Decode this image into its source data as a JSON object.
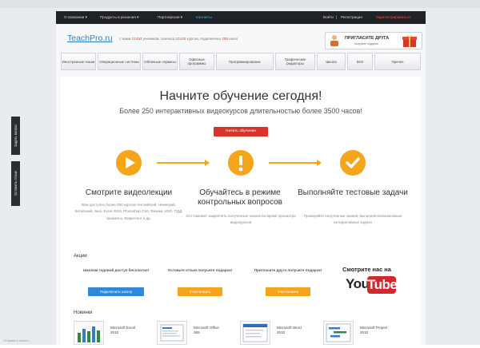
{
  "colors": {
    "accent_orange": "#f4a51c",
    "accent_red": "#d8342a",
    "link_blue": "#2b7fc0",
    "topbar": "#1f2326"
  },
  "topbar": {
    "left_items": [
      "О компании ▾",
      "Продукты и решения ▾",
      "Партнерская ▾",
      "Контакты"
    ],
    "login": "Войти",
    "separator": "|",
    "register": "Регистрация",
    "cart": "Зарегистрироваться"
  },
  "header": {
    "logo": "TeachPro.ru",
    "stats_prefix": "с нами",
    "stats_students": "21493",
    "stats_middle": "учеников, сначала",
    "stats_courses": "10145",
    "stats_after": "курсов, подключено",
    "stats_schools": "269",
    "stats_suffix": "школ",
    "invite_title": "ПРИГЛАСИТЕ ДРУГА",
    "invite_sub": "получите подарок"
  },
  "menu": [
    "Иностранные языки",
    "Операционные системы",
    "Облачные сервисы",
    "Офисные программы",
    "Программирование",
    "Графические редакторы",
    "Школа",
    "ВУЗ",
    "Прочее"
  ],
  "hero": {
    "headline": "Начните обучение сегодня!",
    "subline": "Более 250 интерактивных видеокурсов длительностью более 3500 часов!",
    "start_button": "Начать обучение"
  },
  "steps": [
    {
      "icon": "play-icon",
      "title": "Смотрите видеолекции",
      "text": "Вам доступно более 250 курсов! Английский, Немецкий, Китайский, Java, Excel 2010, Photoshop CS6, Физика, ИЗО, ПДД, Шахматы, Маркетинг и др."
    },
    {
      "icon": "exclamation-icon",
      "title": "Обучайтесь в режиме контрольных вопросов",
      "text": "Это поможет закреплять полученные знания во время просмотра видеоуроков"
    },
    {
      "icon": "check-icon",
      "title": "Выполняйте тестовые задачи",
      "text": "Проверяйте полученные знания, выполняя всевозможные интерактивные задачи"
    }
  ],
  "promo": {
    "heading": "Акции",
    "items": [
      {
        "title": "Школам годовой доступ бесплатно!",
        "button": "Подключить школу",
        "color": "#2f88d8"
      },
      {
        "title": "Оставьте отзыв получите подарок!",
        "button": "Участвовать",
        "color": "#f4a51c"
      },
      {
        "title": "Пригласите друга получите подарок!",
        "button": "Участвовать",
        "color": "#f4a51c"
      }
    ],
    "youtube_title": "Смотрите нас на",
    "youtube_you": "You",
    "youtube_tube": "Tube"
  },
  "news": {
    "heading": "Новинки",
    "items": [
      {
        "label": "Microsoft Excel 2010"
      },
      {
        "label": "Microsoft Office 365"
      },
      {
        "label": "Microsoft Word 2010"
      },
      {
        "label": "Microsoft Project 2010"
      }
    ]
  },
  "side_tabs": [
    "Задать вопрос",
    "Оставить отзыв"
  ],
  "status": "Отправить запрос..."
}
